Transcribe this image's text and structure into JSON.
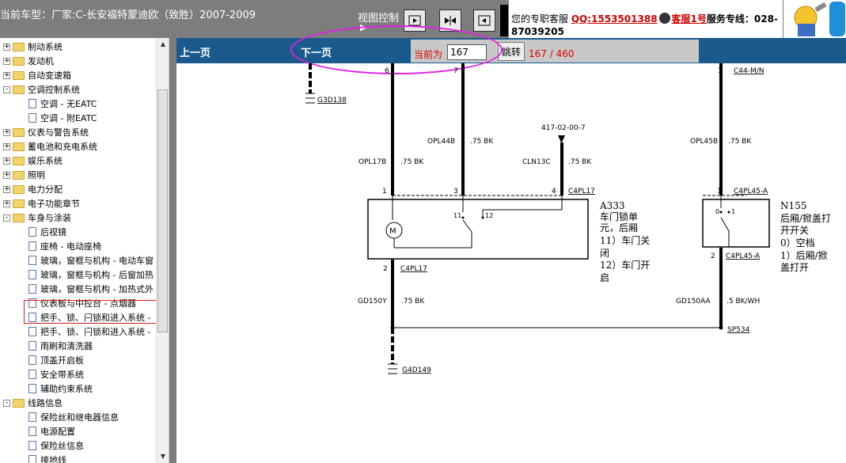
{
  "header": {
    "car_label": "当前车型：厂家:C-长安福特蒙迪欧（致胜）2007-2009",
    "view_control": "视图控制",
    "view_sub": "▶",
    "service_prefix": "您的专职客服",
    "qq": "QQ:1553501388",
    "kefu": "客服1号",
    "hotline": "服务专线：028-87039205"
  },
  "sidebar": {
    "items": [
      {
        "label": "制动系统",
        "type": "folder",
        "expander": "+"
      },
      {
        "label": "发动机",
        "type": "folder",
        "expander": "+"
      },
      {
        "label": "自动变速箱",
        "type": "folder",
        "expander": "+"
      },
      {
        "label": "空调控制系统",
        "type": "folder",
        "expander": "-"
      },
      {
        "label": "空调 - 无EATC",
        "type": "doc"
      },
      {
        "label": "空调 - 附EATC",
        "type": "doc"
      },
      {
        "label": "仪表与警告系统",
        "type": "folder",
        "expander": "+"
      },
      {
        "label": "蓄电池和充电系统",
        "type": "folder",
        "expander": "+"
      },
      {
        "label": "娱乐系统",
        "type": "folder",
        "expander": "+"
      },
      {
        "label": "照明",
        "type": "folder",
        "expander": "+"
      },
      {
        "label": "电力分配",
        "type": "folder",
        "expander": "+"
      },
      {
        "label": "电子功能章节",
        "type": "folder",
        "expander": "+"
      },
      {
        "label": "车身与涂装",
        "type": "folder",
        "expander": "-"
      },
      {
        "label": "后视镜",
        "type": "doc"
      },
      {
        "label": "座椅 - 电动座椅",
        "type": "doc"
      },
      {
        "label": "玻璃，窗框与机构 - 电动车窗",
        "type": "doc"
      },
      {
        "label": "玻璃，窗框与机构 - 后窗加热",
        "type": "doc"
      },
      {
        "label": "玻璃，窗框与机构 - 加热式外",
        "type": "doc"
      },
      {
        "label": "仪表板与中控台 - 点烟器",
        "type": "doc"
      },
      {
        "label": "把手、锁、闩锁和进入系统 -",
        "type": "doc"
      },
      {
        "label": "把手、锁、闩锁和进入系统 -",
        "type": "doc"
      },
      {
        "label": "雨刷和清洗器",
        "type": "doc"
      },
      {
        "label": "顶盖开启板",
        "type": "doc"
      },
      {
        "label": "安全带系统",
        "type": "doc"
      },
      {
        "label": "辅助约束系统",
        "type": "doc"
      },
      {
        "label": "线路信息",
        "type": "folder",
        "expander": "-"
      },
      {
        "label": "保险丝和继电器信息",
        "type": "doc"
      },
      {
        "label": "电源配置",
        "type": "doc"
      },
      {
        "label": "保险丝信息",
        "type": "doc"
      },
      {
        "label": "接地线",
        "type": "doc"
      }
    ]
  },
  "nav": {
    "prev": "上一页",
    "next": "下一页",
    "current_label": "当前为",
    "page_value": "167",
    "jump": "跳转",
    "page_count": "167 / 460"
  },
  "diagram": {
    "labels": {
      "g3d138": "G3D138",
      "pin6": "6",
      "pin7": "7",
      "opl44b": "OPL44B",
      "opl44b_w": ".75 BK",
      "ref417": "417-02-00-7",
      "opl17b": "OPL17B",
      "opl17b_w": ".75 BK",
      "cln13c": "CLN13C",
      "cln13c_w": ".75 BK",
      "pin1a": "1",
      "pin3": "3",
      "pin4": "4",
      "c4pl17_top": "C4PL17",
      "pin11": "11",
      "pin12": "12",
      "pin2a": "2",
      "c4pl17_bot": "C4PL17",
      "gd150y": "GD150Y",
      "gd150y_w": ".75 BK",
      "g4d149": "G4D149",
      "a333_code": "A333",
      "a333_l1": "车门锁单",
      "a333_l2": "元，后厢",
      "a333_l3": "11）车门关",
      "a333_l4": "闭",
      "a333_l5": "12）车门开",
      "a333_l6": "启",
      "pin1c": "1",
      "c44mn": "C44-M/N",
      "opl45b": "OPL45B",
      "opl45b_w": ".75 BK",
      "pin1b": "1",
      "c4pl45a_top": "C4PL45-A",
      "sw0": "0",
      "sw1": "1",
      "pin2b": "2",
      "c4pl45a_bot": "C4PL45-A",
      "n155_code": "N155",
      "n155_l1": "后厢/掀盖打",
      "n155_l2": "开开关",
      "n155_l3": "0）空档",
      "n155_l4": "1）后厢/掀",
      "n155_l5": "盖打开",
      "gd150aa": "GD150AA",
      "gd150aa_w": ".5 BK/WH",
      "sp534": "SP534",
      "motor": "M"
    }
  }
}
